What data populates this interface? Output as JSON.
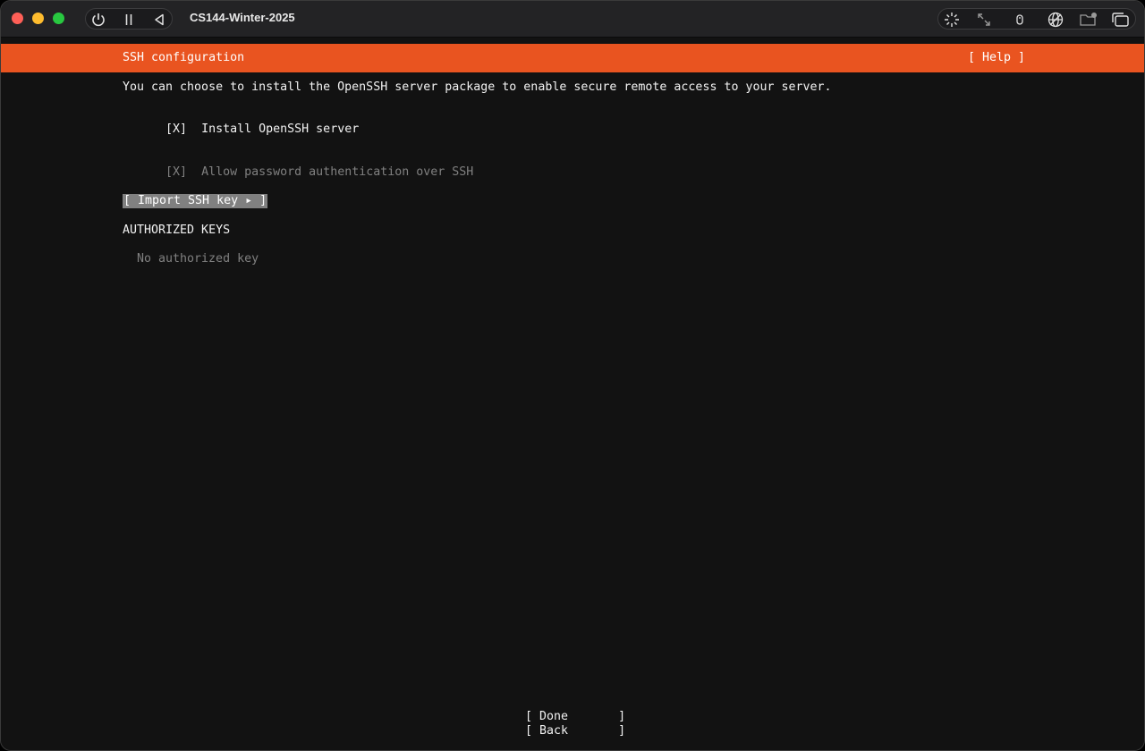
{
  "window": {
    "title": "CS144-Winter-2025",
    "controls": [
      "power-icon",
      "pause-icon",
      "back-icon"
    ],
    "tools": [
      "sparkle-icon",
      "resize-icon",
      "mouse-icon",
      "network-icon",
      "shared-folder-icon",
      "windows-icon"
    ]
  },
  "installer": {
    "header": "SSH configuration",
    "help": "[ Help ]",
    "intro": "You can choose to install the OpenSSH server package to enable secure remote access to your server.",
    "install_checkbox": "[X]",
    "install_label": "Install OpenSSH server",
    "password_checkbox": "[X]",
    "password_label": "Allow password authentication over SSH",
    "import_button": "[ Import SSH key ▸ ]",
    "authorized_keys_heading": "AUTHORIZED KEYS",
    "no_keys": "No authorized key",
    "done_button": "[ Done       ]",
    "back_button": "[ Back       ]"
  },
  "colors": {
    "accent": "#e95420",
    "background": "#121212",
    "text": "#f2f2f2",
    "disabled": "#808080"
  }
}
